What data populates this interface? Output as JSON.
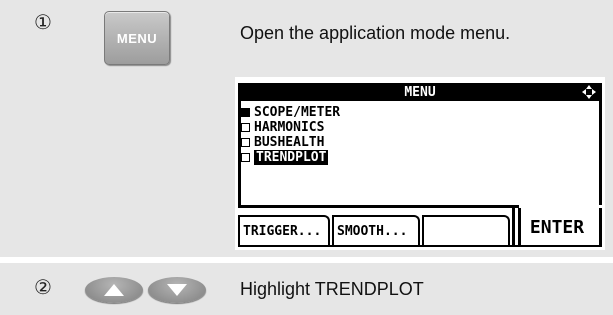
{
  "step1": {
    "number": "①",
    "key_label": "MENU",
    "instruction": "Open the application mode menu."
  },
  "screen": {
    "title": "MENU",
    "items": [
      {
        "label": "SCOPE/METER",
        "checked": true,
        "highlighted": false
      },
      {
        "label": "HARMONICS",
        "checked": false,
        "highlighted": false
      },
      {
        "label": "BUSHEALTH",
        "checked": false,
        "highlighted": false
      },
      {
        "label": "TRENDPLOT",
        "checked": false,
        "highlighted": true
      }
    ],
    "softkeys": [
      "TRIGGER...",
      "SMOOTH...",
      "",
      "ENTER"
    ]
  },
  "step2": {
    "number": "②",
    "instruction": "Highlight TRENDPLOT",
    "keys": [
      "arrow-up-icon",
      "arrow-down-icon"
    ]
  },
  "colors": {
    "panel": "#e6e6e6",
    "key": "#9d9d9d"
  }
}
